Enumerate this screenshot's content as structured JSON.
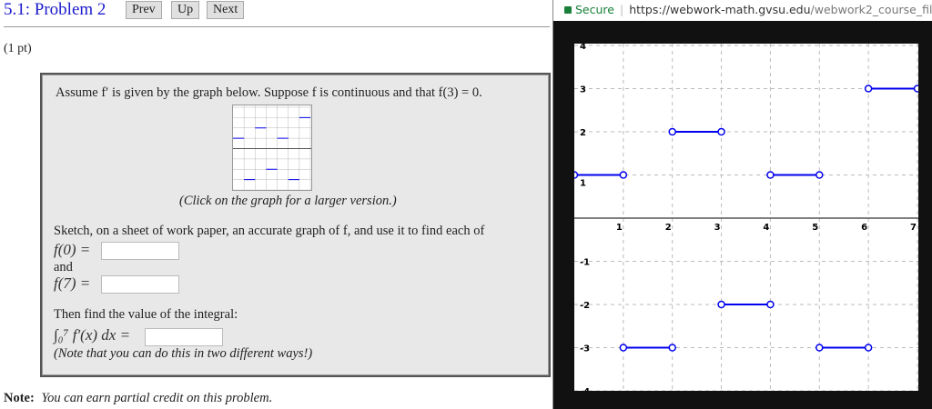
{
  "header": {
    "title": "5.1: Problem 2",
    "prev": "Prev",
    "up": "Up",
    "next": "Next"
  },
  "points": "(1 pt)",
  "problem": {
    "intro": "Assume f′ is given by the graph below. Suppose f is continuous and that f(3) = 0.",
    "caption": "(Click on the graph for a larger version.)",
    "sketch": "Sketch, on a sheet of work paper, an accurate graph of f, and use it to find each of",
    "f0_label": "f(0) =",
    "f0_value": "",
    "and": "and",
    "f7_label": "f(7) =",
    "f7_value": "",
    "then": "Then find the value of the integral:",
    "integral_label": "∫₀⁷ f′(x) dx =",
    "integral_value": "",
    "hint": "(Note that you can do this in two different ways!)"
  },
  "note": {
    "label": "Note:",
    "text": "You can earn partial credit on this problem."
  },
  "browser": {
    "secure": "Secure",
    "url_host": "https://webwork-math.gvsu.edu",
    "url_path": "/webwork2_course_files/"
  },
  "colors": {
    "segment": "#0000ee",
    "link": "#1a1acc",
    "secure": "#188038"
  },
  "chart_data": {
    "type": "line",
    "title": "Graph of f′",
    "xlim": [
      0,
      7
    ],
    "ylim": [
      -4,
      4
    ],
    "xticks": [
      1,
      2,
      3,
      4,
      5,
      6,
      7
    ],
    "yticks": [
      4,
      3,
      2,
      1,
      -1,
      -2,
      -3,
      -4
    ],
    "grid": true,
    "segments": [
      {
        "x": [
          0,
          1
        ],
        "y": 1
      },
      {
        "x": [
          1,
          2
        ],
        "y": -3
      },
      {
        "x": [
          2,
          3
        ],
        "y": 2
      },
      {
        "x": [
          3,
          4
        ],
        "y": -2
      },
      {
        "x": [
          4,
          5
        ],
        "y": 1
      },
      {
        "x": [
          5,
          6
        ],
        "y": -3
      },
      {
        "x": [
          6,
          7
        ],
        "y": 3
      }
    ],
    "endpoints": "open"
  }
}
